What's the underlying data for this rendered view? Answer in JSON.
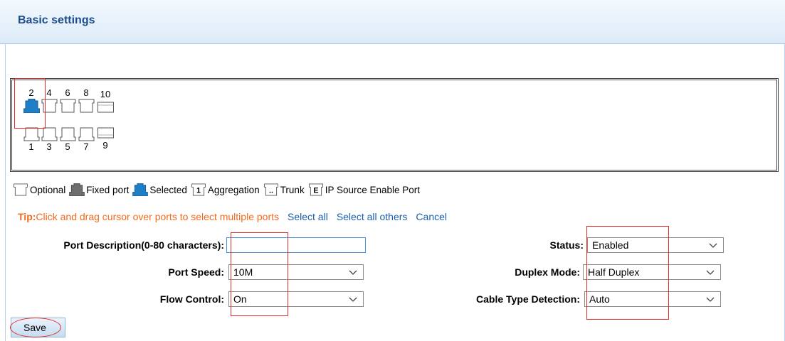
{
  "header": {
    "title": "Basic settings"
  },
  "ports": {
    "top_row": [
      "2",
      "4",
      "6",
      "8",
      "10"
    ],
    "bottom_row": [
      "1",
      "3",
      "5",
      "7",
      "9"
    ]
  },
  "legend": {
    "optional": "Optional",
    "fixed_port": "Fixed port",
    "selected": "Selected",
    "aggregation_glyph": "1",
    "aggregation": "Aggregation",
    "trunk_glyph": "..",
    "trunk": "Trunk",
    "ip_source_glyph": "E",
    "ip_source": "IP Source Enable Port"
  },
  "tip": {
    "label": "Tip:",
    "text": "Click and drag cursor over ports to select multiple ports",
    "select_all": "Select all",
    "select_all_others": "Select all others",
    "cancel": "Cancel"
  },
  "form": {
    "port_description_label": "Port Description(0-80 characters):",
    "port_description_value": "",
    "status_label": "Status:",
    "status_value": "Enabled",
    "port_speed_label": "Port Speed:",
    "port_speed_value": "10M",
    "duplex_mode_label": "Duplex Mode:",
    "duplex_mode_value": "Half Duplex",
    "flow_control_label": "Flow Control:",
    "flow_control_value": "On",
    "cable_type_label": "Cable Type Detection:",
    "cable_type_value": "Auto"
  },
  "actions": {
    "save": "Save"
  },
  "colors": {
    "header_title": "#1c4e8c",
    "tip": "#f26a1b",
    "link": "#1a5da8",
    "selected_port": "#1e7fc6",
    "annotation_red": "#e02a2a"
  }
}
